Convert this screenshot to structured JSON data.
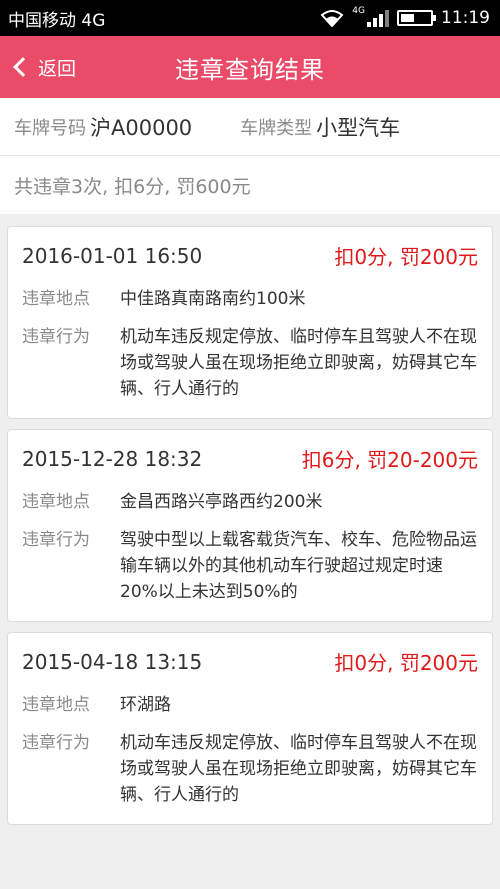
{
  "statusbar": {
    "carrier": "中国移动 4G",
    "network": "4G",
    "time": "11:19"
  },
  "header": {
    "back_label": "返回",
    "title": "违章查询结果"
  },
  "plate": {
    "number_label": "车牌号码",
    "number_value": "沪A00000",
    "type_label": "车牌类型",
    "type_value": "小型汽车"
  },
  "summary": "共违章3次, 扣6分, 罚600元",
  "location_label": "违章地点",
  "behavior_label": "违章行为",
  "violations": [
    {
      "time": "2016-01-01 16:50",
      "penalty": "扣0分, 罚200元",
      "location": "中佳路真南路南约100米",
      "behavior": "机动车违反规定停放、临时停车且驾驶人不在现场或驾驶人虽在现场拒绝立即驶离，妨碍其它车辆、行人通行的"
    },
    {
      "time": "2015-12-28 18:32",
      "penalty": "扣6分, 罚20-200元",
      "location": "金昌西路兴亭路西约200米",
      "behavior": "驾驶中型以上载客载货汽车、校车、危险物品运输车辆以外的其他机动车行驶超过规定时速20%以上未达到50%的"
    },
    {
      "time": "2015-04-18 13:15",
      "penalty": "扣0分, 罚200元",
      "location": "环湖路",
      "behavior": "机动车违反规定停放、临时停车且驾驶人不在现场或驾驶人虽在现场拒绝立即驶离，妨碍其它车辆、行人通行的"
    }
  ]
}
